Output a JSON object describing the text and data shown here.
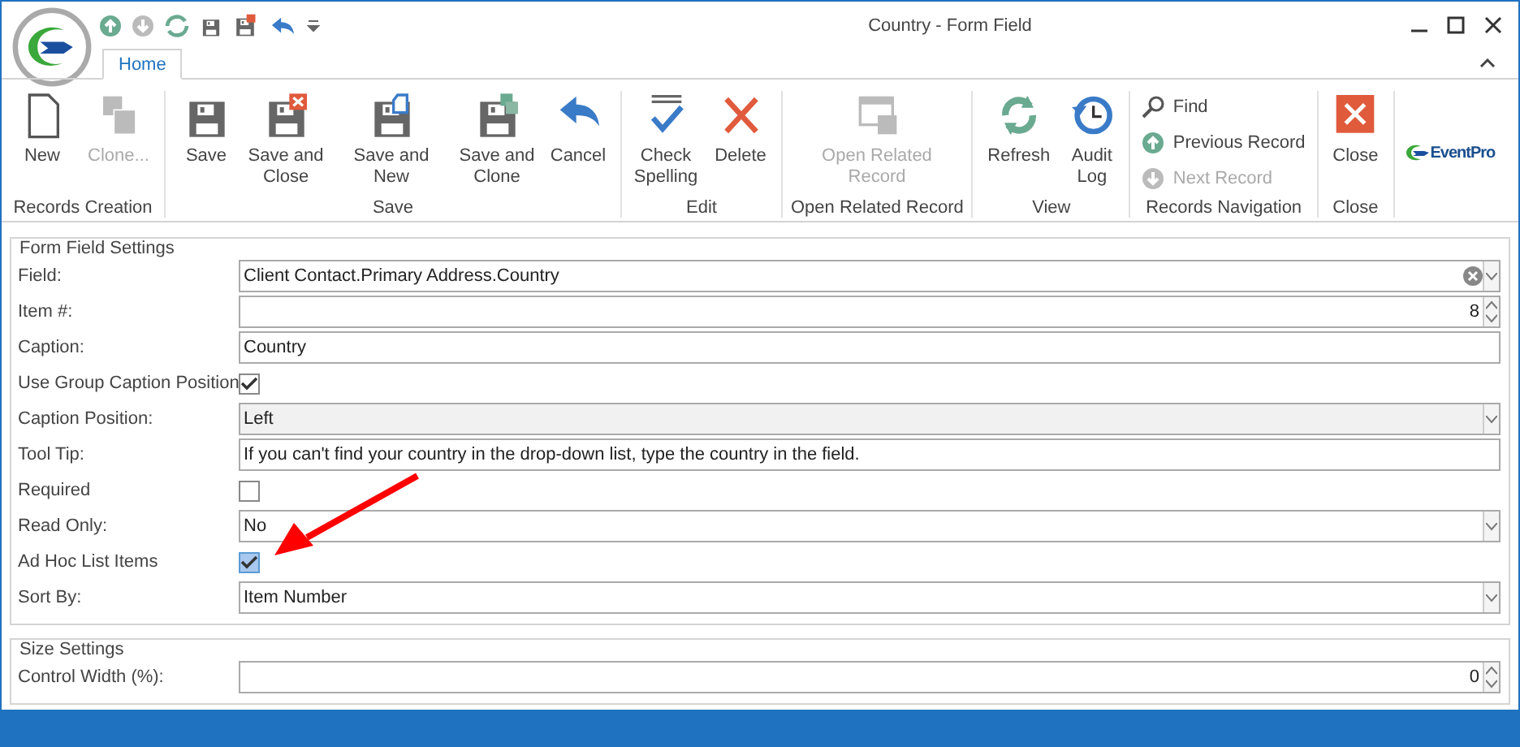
{
  "window": {
    "title": "Country - Form Field"
  },
  "tabs": [
    {
      "label": "Home",
      "selected": true
    }
  ],
  "ribbon": {
    "groups": [
      {
        "label": "Records Creation",
        "kind": "large",
        "buttons": [
          {
            "label": "New",
            "disabled": false
          },
          {
            "label": "Clone...",
            "disabled": true
          }
        ]
      },
      {
        "label": "Save",
        "kind": "large",
        "buttons": [
          {
            "label": "Save",
            "disabled": false
          },
          {
            "label": "Save and Close",
            "disabled": false
          },
          {
            "label": "Save and New",
            "disabled": false
          },
          {
            "label": "Save and Clone",
            "disabled": false
          },
          {
            "label": "Cancel",
            "disabled": false
          }
        ]
      },
      {
        "label": "Edit",
        "kind": "large",
        "buttons": [
          {
            "label": "Check Spelling",
            "disabled": false
          },
          {
            "label": "Delete",
            "disabled": false
          }
        ]
      },
      {
        "label": "Open Related Record",
        "kind": "large",
        "buttons": [
          {
            "label": "Open Related Record",
            "disabled": true
          }
        ]
      },
      {
        "label": "View",
        "kind": "large",
        "buttons": [
          {
            "label": "Refresh",
            "disabled": false
          },
          {
            "label": "Audit Log",
            "disabled": false
          }
        ]
      },
      {
        "label": "Records Navigation",
        "kind": "small",
        "buttons": [
          {
            "label": "Find",
            "disabled": false
          },
          {
            "label": "Previous Record",
            "disabled": false
          },
          {
            "label": "Next Record",
            "disabled": true
          }
        ]
      },
      {
        "label": "Close",
        "kind": "large",
        "buttons": [
          {
            "label": "Close",
            "disabled": false
          }
        ]
      }
    ],
    "logo_text": "EventPro"
  },
  "sections": [
    {
      "title": "Form Field Settings",
      "rows": [
        {
          "label": "Field:",
          "kind": "lookup",
          "value": "Client Contact.Primary Address.Country"
        },
        {
          "label": "Item #:",
          "kind": "spin",
          "value": "8"
        },
        {
          "label": "Caption:",
          "kind": "text",
          "value": "Country"
        },
        {
          "label": "Use Group Caption Position",
          "kind": "check",
          "checked": true,
          "focused": false
        },
        {
          "label": "Caption Position:",
          "kind": "combo",
          "value": "Left",
          "disabled": true
        },
        {
          "label": "Tool Tip:",
          "kind": "text",
          "value": "If you can't find your country in the drop-down list, type the country in the field."
        },
        {
          "label": "Required",
          "kind": "check",
          "checked": false,
          "focused": false
        },
        {
          "label": "Read Only:",
          "kind": "combo",
          "value": "No",
          "disabled": false
        },
        {
          "label": "Ad Hoc List Items",
          "kind": "check",
          "checked": true,
          "focused": true
        },
        {
          "label": "Sort By:",
          "kind": "combo",
          "value": "Item Number",
          "disabled": false
        }
      ]
    },
    {
      "title": "Size Settings",
      "rows": [
        {
          "label": "Control Width (%):",
          "kind": "spin",
          "value": "0"
        }
      ]
    }
  ]
}
